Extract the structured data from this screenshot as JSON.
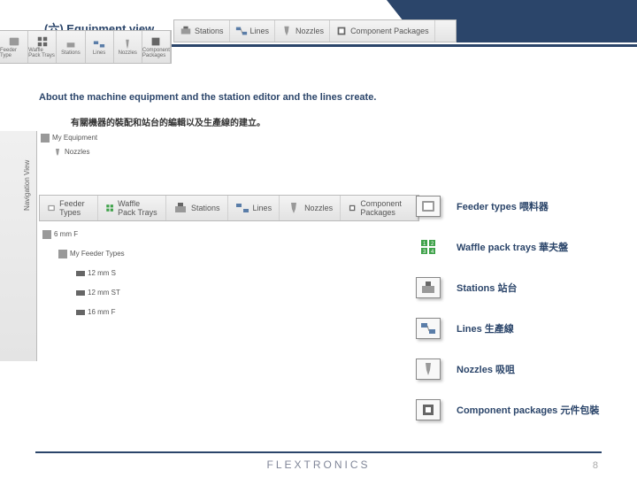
{
  "title": "(六) Equipment view",
  "desc1": "About the machine equipment and the station editor and the lines create.",
  "desc2": "有關機器的裝配和站台的編輯以及生產線的建立。",
  "toolbar1": [
    "Feeder Type",
    "Waffle Pack Trays",
    "Stations",
    "Lines",
    "Nozzles",
    "Component Packages"
  ],
  "toolbar2": [
    {
      "label": "Stations"
    },
    {
      "label": "Lines"
    },
    {
      "label": "Nozzles"
    },
    {
      "label": "Component Packages"
    }
  ],
  "toolbar3": [
    {
      "label": "Feeder Types"
    },
    {
      "label": "Waffle Pack Trays"
    },
    {
      "label": "Stations"
    },
    {
      "label": "Lines"
    },
    {
      "label": "Nozzles"
    },
    {
      "label": "Component Packages"
    }
  ],
  "tree": [
    {
      "label": "My Equipment",
      "indent": false
    },
    {
      "label": "Nozzles",
      "indent": true
    }
  ],
  "tree2": [
    {
      "label": "6 mm F",
      "cls": "node"
    },
    {
      "label": "My Feeder Types",
      "cls": "node sub"
    },
    {
      "label": "12 mm S",
      "cls": "node subsub"
    },
    {
      "label": "12 mm ST",
      "cls": "node subsub"
    },
    {
      "label": "16 mm F",
      "cls": "node subsub"
    }
  ],
  "legend": [
    {
      "label": "Feeder types 喂料器",
      "icon": "feeder"
    },
    {
      "label": "Waffle pack trays 華夫盤",
      "icon": "waffle"
    },
    {
      "label": "Stations  站台",
      "icon": "station"
    },
    {
      "label": "Lines 生產線",
      "icon": "lines"
    },
    {
      "label": "Nozzles 吸咀",
      "icon": "nozzle"
    },
    {
      "label": "Component packages 元件包裝",
      "icon": "comp"
    }
  ],
  "footer": {
    "logo": "FLEXTRONICS",
    "page": "8"
  }
}
